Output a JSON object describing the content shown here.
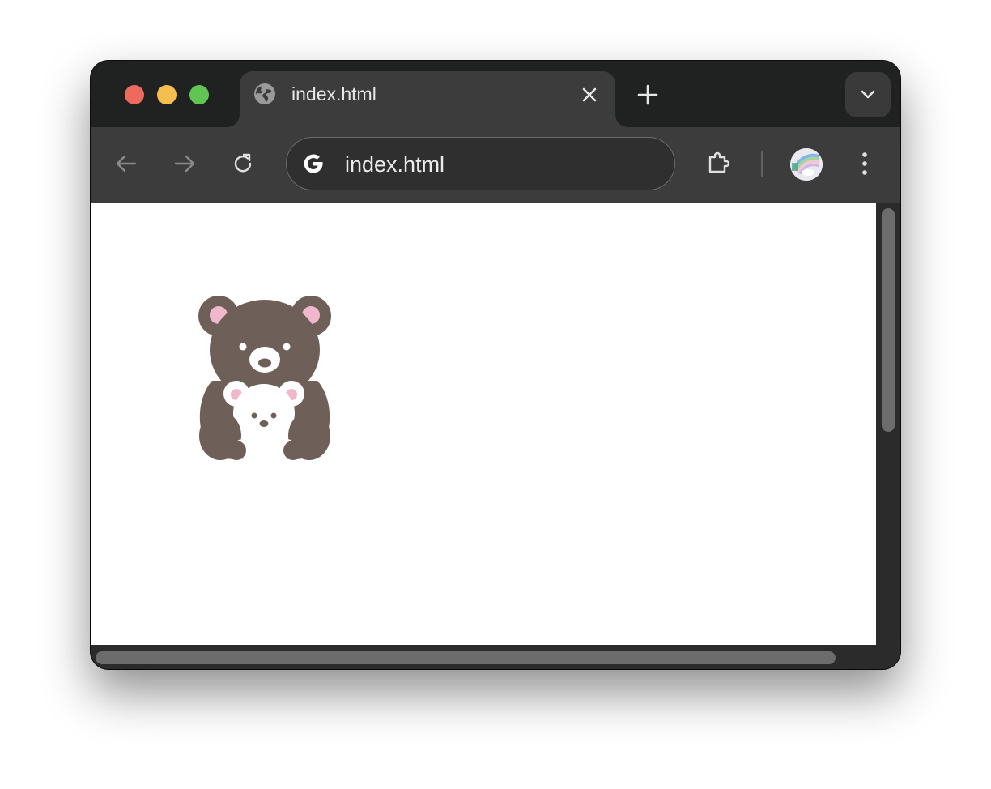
{
  "window": {
    "controls": [
      "close",
      "minimize",
      "zoom"
    ]
  },
  "tabs": [
    {
      "title": "index.html",
      "favicon": "globe-icon",
      "active": true
    }
  ],
  "tabstrip": {
    "new_tab_icon": "plus-icon",
    "tab_search_icon": "chevron-down-icon"
  },
  "toolbar": {
    "back_icon": "arrow-left-icon",
    "forward_icon": "arrow-right-icon",
    "reload_icon": "reload-icon",
    "address": "index.html",
    "search_engine_icon": "google-g-icon",
    "extensions_icon": "puzzle-icon",
    "menu_icon": "kebab-menu-icon"
  },
  "page": {
    "image": "bear-mother-and-cub-illustration"
  },
  "colors": {
    "bear_brown": "#6e6058",
    "ear_pink": "#f1b8cb",
    "cub_white": "#ffffff",
    "chrome_dark": "#202222",
    "toolbar": "#3c3c3c"
  }
}
